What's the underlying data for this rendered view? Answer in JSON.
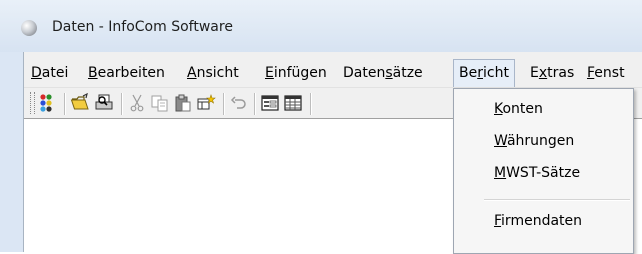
{
  "window": {
    "title": "Daten - InfoCom Software"
  },
  "menubar": {
    "items": [
      {
        "label": "Datei",
        "mnemonic": "D"
      },
      {
        "label": "Bearbeiten",
        "mnemonic": "B"
      },
      {
        "label": "Ansicht",
        "mnemonic": "A"
      },
      {
        "label": "Einfügen",
        "mnemonic": "E"
      },
      {
        "label": "Datensätze",
        "mnemonic": "s"
      },
      {
        "label": "Bericht",
        "mnemonic": "r",
        "active": true
      },
      {
        "label": "Extras",
        "mnemonic": "x"
      },
      {
        "label": "Fenst",
        "mnemonic": "F"
      }
    ]
  },
  "toolbar": {
    "icons": [
      "colors-icon",
      "open-folder-icon",
      "print-preview-icon",
      "cut-icon",
      "copy-icon",
      "paste-icon",
      "new-record-icon",
      "undo-icon",
      "form-view-icon",
      "table-view-icon"
    ]
  },
  "bericht_menu": {
    "items": [
      {
        "label": "Konten",
        "mnemonic": "K"
      },
      {
        "label": "Währungen",
        "mnemonic": "W"
      },
      {
        "label": "MWST-Sätze",
        "mnemonic": "M"
      },
      {
        "label": "Firmendaten",
        "mnemonic": "F"
      }
    ]
  },
  "colors": {
    "titlebar": "#dbe6f4",
    "menu_highlight": "#e6eef8",
    "dropdown_bg": "#f6f6f6"
  }
}
